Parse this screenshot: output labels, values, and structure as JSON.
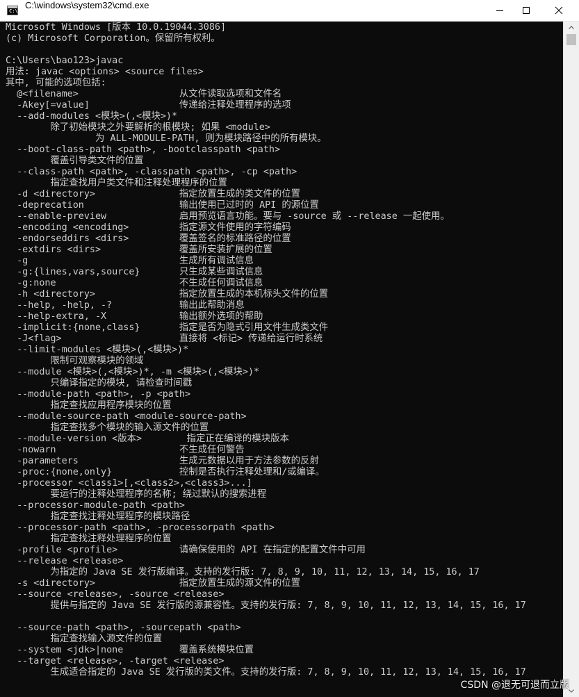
{
  "window": {
    "title": "C:\\windows\\system32\\cmd.exe",
    "icon": "cmd-icon",
    "controls": {
      "minimize": "minimize-icon",
      "maximize": "maximize-icon",
      "close": "close-icon"
    }
  },
  "console": {
    "lines": [
      "Microsoft Windows [版本 10.0.19044.3086]",
      "(c) Microsoft Corporation。保留所有权利。",
      "",
      "C:\\Users\\bao123>javac",
      "用法: javac <options> <source files>",
      "其中, 可能的选项包括:",
      "  @<filename>                  从文件读取选项和文件名",
      "  -Akey[=value]                传递给注释处理程序的选项",
      "  --add-modules <模块>(,<模块>)*",
      "        除了初始模块之外要解析的根模块; 如果 <module>",
      "                为 ALL-MODULE-PATH, 则为模块路径中的所有模块。",
      "  --boot-class-path <path>, -bootclasspath <path>",
      "        覆盖引导类文件的位置",
      "  --class-path <path>, -classpath <path>, -cp <path>",
      "        指定查找用户类文件和注释处理程序的位置",
      "  -d <directory>               指定放置生成的类文件的位置",
      "  -deprecation                 输出使用已过时的 API 的源位置",
      "  --enable-preview             启用预览语言功能。要与 -source 或 --release 一起使用。",
      "  -encoding <encoding>         指定源文件使用的字符编码",
      "  -endorseddirs <dirs>         覆盖签名的标准路径的位置",
      "  -extdirs <dirs>              覆盖所安装扩展的位置",
      "  -g                           生成所有调试信息",
      "  -g:{lines,vars,source}       只生成某些调试信息",
      "  -g:none                      不生成任何调试信息",
      "  -h <directory>               指定放置生成的本机标头文件的位置",
      "  --help, -help, -?            输出此帮助消息",
      "  --help-extra, -X             输出额外选项的帮助",
      "  -implicit:{none,class}       指定是否为隐式引用文件生成类文件",
      "  -J<flag>                     直接将 <标记> 传递给运行时系统",
      "  --limit-modules <模块>(,<模块>)*",
      "        限制可观察模块的领域",
      "  --module <模块>(,<模块>)*, -m <模块>(,<模块>)*",
      "        只编译指定的模块, 请检查时间戳",
      "  --module-path <path>, -p <path>",
      "        指定查找应用程序模块的位置",
      "  --module-source-path <module-source-path>",
      "        指定查找多个模块的输入源文件的位置",
      "  --module-version <版本>        指定正在编译的模块版本",
      "  -nowarn                      不生成任何警告",
      "  -parameters                  生成元数据以用于方法参数的反射",
      "  -proc:{none,only}            控制是否执行注释处理和/或编译。",
      "  -processor <class1>[,<class2>,<class3>...]",
      "        要运行的注释处理程序的名称; 绕过默认的搜索进程",
      "  --processor-module-path <path>",
      "        指定查找注释处理程序的模块路径",
      "  --processor-path <path>, -processorpath <path>",
      "        指定查找注释处理程序的位置",
      "  -profile <profile>           请确保使用的 API 在指定的配置文件中可用",
      "  --release <release>",
      "        为指定的 Java SE 发行版编译。支持的发行版: 7, 8, 9, 10, 11, 12, 13, 14, 15, 16, 17",
      "  -s <directory>               指定放置生成的源文件的位置",
      "  --source <release>, -source <release>",
      "        提供与指定的 Java SE 发行版的源兼容性。支持的发行版: 7, 8, 9, 10, 11, 12, 13, 14, 15, 16, 17",
      "",
      "  --source-path <path>, -sourcepath <path>",
      "        指定查找输入源文件的位置",
      "  --system <jdk>|none          覆盖系统模块位置",
      "  --target <release>, -target <release>",
      "        生成适合指定的 Java SE 发行版的类文件。支持的发行版: 7, 8, 9, 10, 11, 12, 13, 14, 15, 16, 17"
    ]
  },
  "watermark": "CSDN @退无可退而立版"
}
